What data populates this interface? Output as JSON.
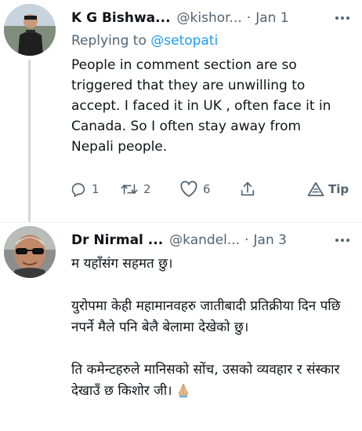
{
  "tweets": [
    {
      "author_name": "K G Bishwa...",
      "handle": "@kishor...",
      "dot": "·",
      "date": "Jan 1",
      "replying_prefix": "Replying to",
      "replying_to": "@setopati",
      "text": "People in comment section are so triggered that they are unwilling to accept. I faced it in UK , often face it in Canada. So I often stay away from Nepali people.",
      "replies": "1",
      "retweets": "2",
      "likes": "6",
      "tip_label": "Tip"
    },
    {
      "author_name": "Dr Nirmal ...",
      "handle": "@kandel...",
      "dot": "·",
      "date": "Jan 3",
      "paragraphs": [
        "म यहाँसंग सहमत छु।",
        "युरोपमा केही महामानवहरु जातीबादी प्रतिक्रीया दिन पछि नपर्ने मैले पनि बेलै बेलामा देखेको छु।",
        "ति कमेन्टहरुले मानिसको सोंच, उसको व्यवहार र संस्कार देखाउँ छ किशोर जी।"
      ]
    }
  ],
  "icons": {
    "reply": "reply-icon",
    "retweet": "retweet-icon",
    "like": "heart-icon",
    "share": "share-icon",
    "tip": "tip-icon",
    "more": "more-icon",
    "emoji": "folded-hands-emoji"
  },
  "colors": {
    "text": "#0f1419",
    "secondary": "#536471",
    "link": "#1d9bf0",
    "thread_line": "#cfd9de"
  }
}
